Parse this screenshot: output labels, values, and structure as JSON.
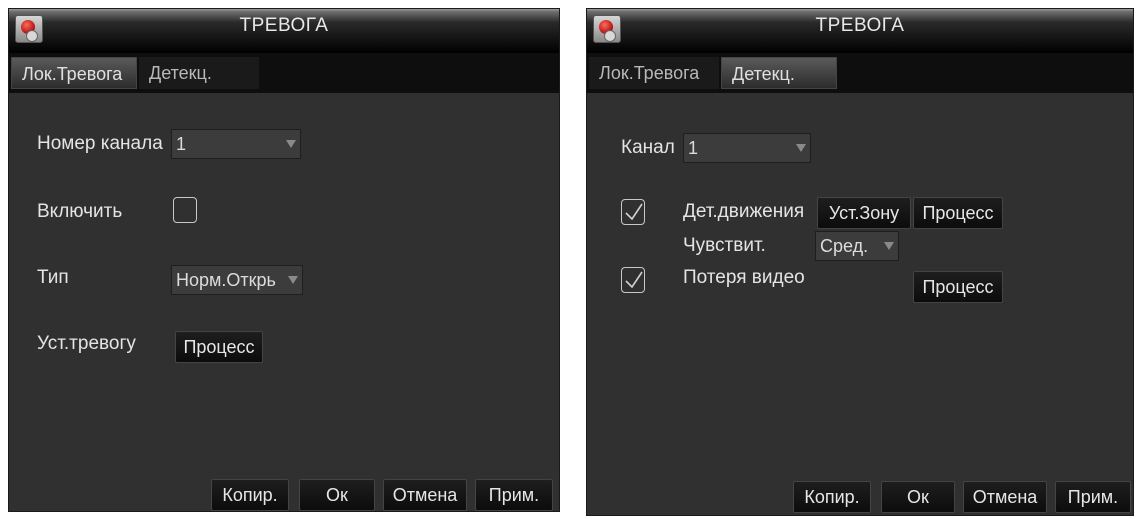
{
  "left_window": {
    "title": "ТРЕВОГА",
    "tabs": [
      {
        "label": "Лок.Тревога",
        "active": true
      },
      {
        "label": "Детекц.",
        "active": false
      }
    ],
    "channel_label": "Номер канала",
    "channel_value": "1",
    "enable_label": "Включить",
    "enable_checked": false,
    "type_label": "Тип",
    "type_value": "Норм.Открь",
    "set_alarm_label": "Уст.тревогу",
    "process_button": "Процесс",
    "footer": {
      "copy": "Копир.",
      "ok": "Ок",
      "cancel": "Отмена",
      "apply": "Прим."
    }
  },
  "right_window": {
    "title": "ТРЕВОГА",
    "tabs": [
      {
        "label": "Лок.Тревога",
        "active": false
      },
      {
        "label": "Детекц.",
        "active": true
      }
    ],
    "channel_label": "Канал",
    "channel_value": "1",
    "motion_label": "Дет.движения",
    "motion_checked": true,
    "set_zone_button": "Уст.Зону",
    "motion_process_button": "Процесс",
    "sensitivity_label": "Чувствит.",
    "sensitivity_value": "Сред.",
    "video_loss_label": "Потеря видео",
    "video_loss_checked": true,
    "video_loss_process_button": "Процесс",
    "footer": {
      "copy": "Копир.",
      "ok": "Ок",
      "cancel": "Отмена",
      "apply": "Прим."
    }
  },
  "colors": {
    "panel_bg": "#303030",
    "title_text": "#e8e8e8",
    "logo_red": "#b01010"
  }
}
